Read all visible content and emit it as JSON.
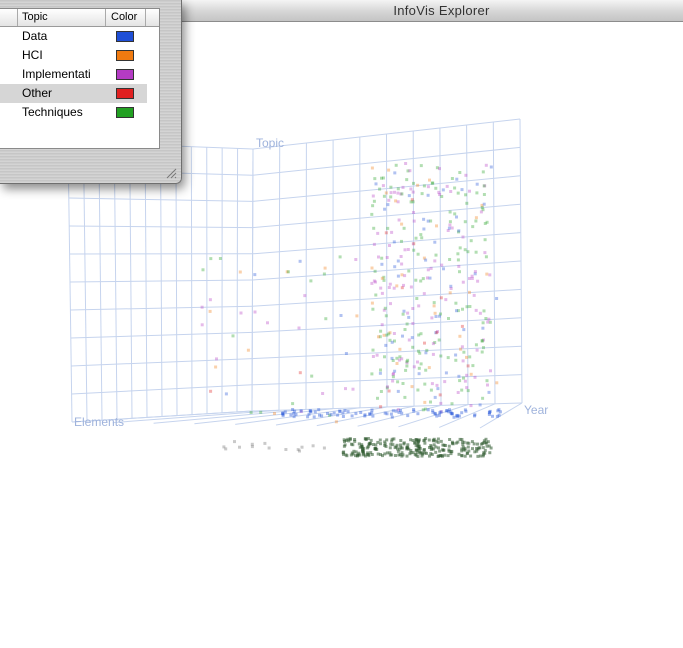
{
  "window": {
    "title": "InfoVis Explorer"
  },
  "legend": {
    "columns": [
      "Topic",
      "Color"
    ],
    "items": [
      {
        "label": "Data",
        "color": "#1f4fd6",
        "selected": false
      },
      {
        "label": "HCI",
        "color": "#f07a10",
        "selected": false
      },
      {
        "label": "Implementati",
        "color": "#b43bc4",
        "selected": false
      },
      {
        "label": "Other",
        "color": "#e02020",
        "selected": true
      },
      {
        "label": "Techniques",
        "color": "#22a022",
        "selected": false
      }
    ]
  },
  "axes": {
    "vertical": "Topic",
    "horizontal": "Year",
    "depth": "Elements"
  },
  "colors": {
    "grid": "#c6d4ee",
    "axis_label": "#9fb3dc",
    "shadow_points": "#2e5a2e"
  }
}
